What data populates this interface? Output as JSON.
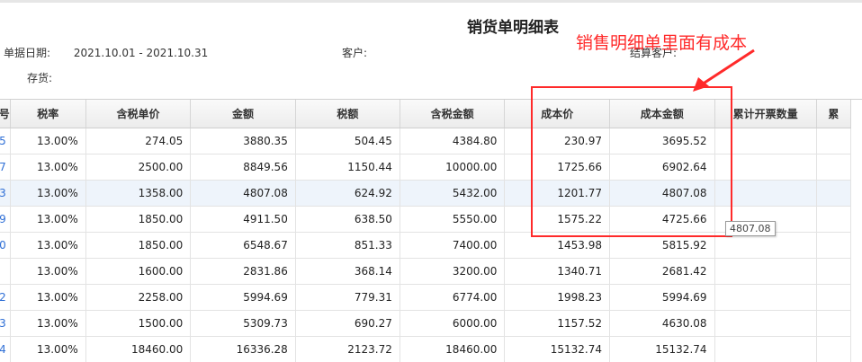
{
  "report": {
    "title": "销货单明细表",
    "date_label": "单据日期:",
    "date_range": "2021.10.01 - 2021.10.31",
    "customer_label": "客户:",
    "settle_customer_label": "结算客户:",
    "inventory_label": "存货:"
  },
  "annotation": {
    "text": "销售明细单里面有成本",
    "color": "#ff2a2a"
  },
  "table": {
    "headers": [
      "号",
      "税率",
      "含税单价",
      "金额",
      "税额",
      "含税金额",
      "成本价",
      "成本金额",
      "累计开票数量",
      "累"
    ],
    "rows": [
      [
        "5",
        "13.00%",
        "274.05",
        "3880.35",
        "504.45",
        "4384.80",
        "230.97",
        "3695.52",
        "",
        ""
      ],
      [
        "7",
        "13.00%",
        "2500.00",
        "8849.56",
        "1150.44",
        "10000.00",
        "1725.66",
        "6902.64",
        "",
        ""
      ],
      [
        "3",
        "13.00%",
        "1358.00",
        "4807.08",
        "624.92",
        "5432.00",
        "1201.77",
        "4807.08",
        "",
        ""
      ],
      [
        "9",
        "13.00%",
        "1850.00",
        "4911.50",
        "638.50",
        "5550.00",
        "1575.22",
        "4725.66",
        "",
        ""
      ],
      [
        "0",
        "13.00%",
        "1850.00",
        "6548.67",
        "851.33",
        "7400.00",
        "1453.98",
        "5815.92",
        "",
        ""
      ],
      [
        "",
        "13.00%",
        "1600.00",
        "2831.86",
        "368.14",
        "3200.00",
        "1340.71",
        "2681.42",
        "",
        ""
      ],
      [
        "2",
        "13.00%",
        "2258.00",
        "5994.69",
        "779.31",
        "6774.00",
        "1998.23",
        "5994.69",
        "",
        ""
      ],
      [
        "3",
        "13.00%",
        "1500.00",
        "5309.73",
        "690.27",
        "6000.00",
        "1157.52",
        "4630.08",
        "",
        ""
      ],
      [
        "4",
        "13.00%",
        "18460.00",
        "16336.28",
        "2123.72",
        "18460.00",
        "15132.74",
        "15132.74",
        "",
        ""
      ]
    ],
    "highlight_row": 2
  },
  "tooltip": {
    "text": "4807.08"
  }
}
